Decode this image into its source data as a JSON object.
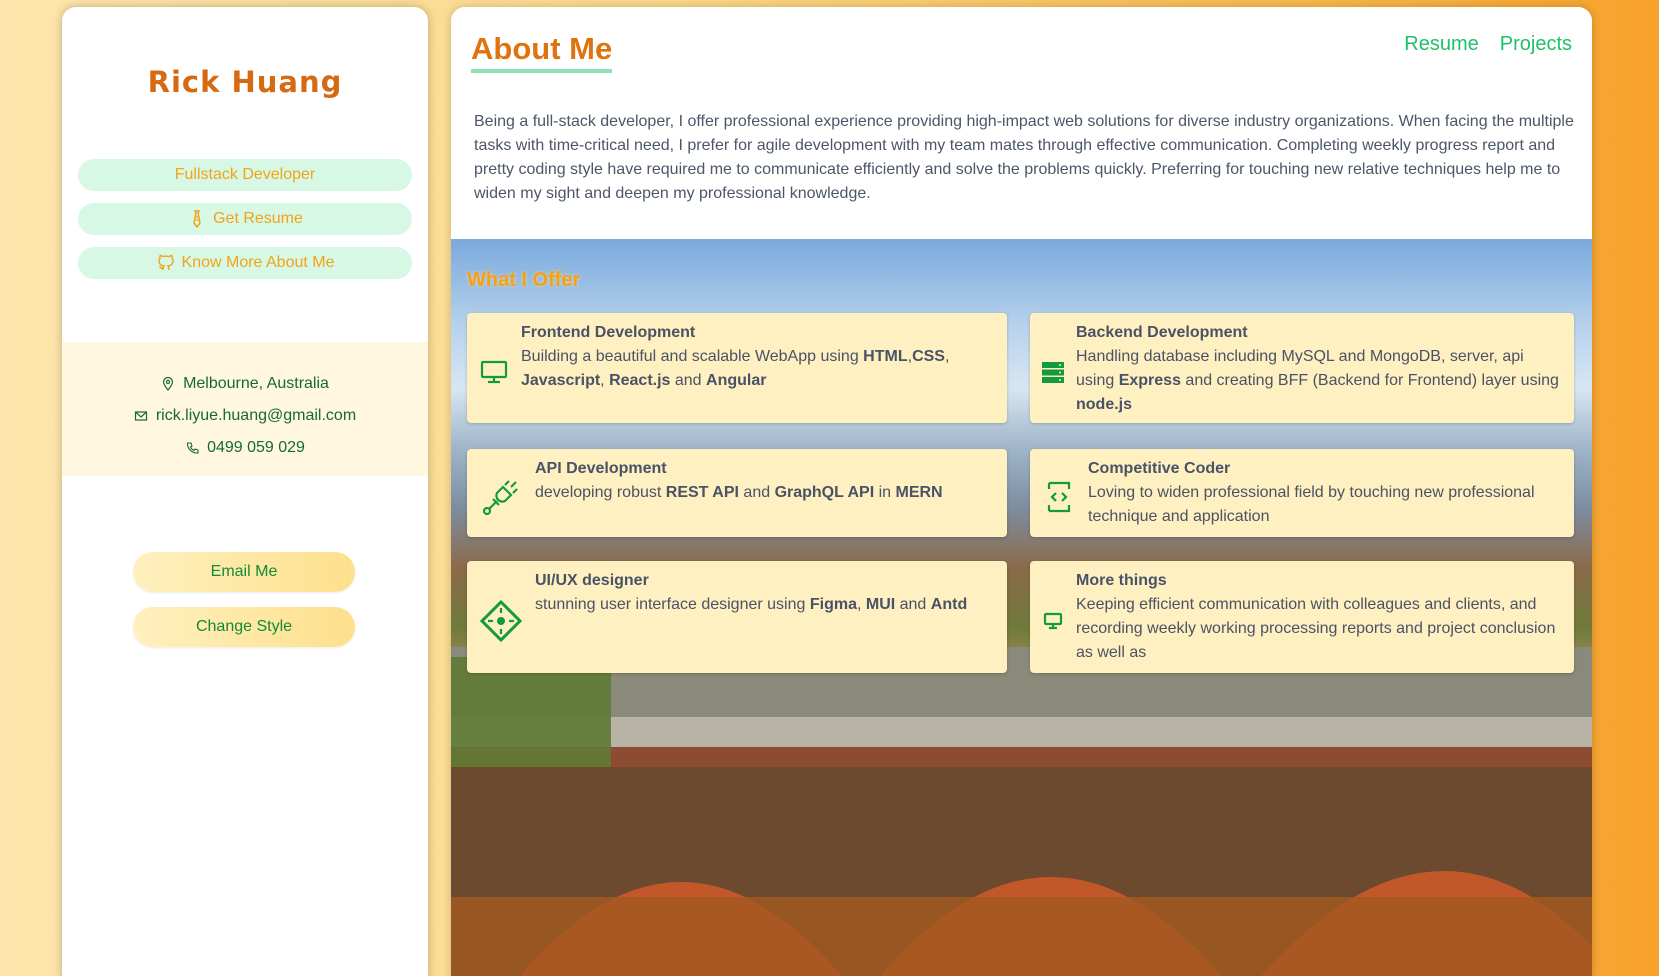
{
  "sidebar": {
    "name": "Rick Huang",
    "pills": [
      {
        "label": "Fullstack Developer",
        "icon": ""
      },
      {
        "label": "Get Resume",
        "icon": "tie-icon"
      },
      {
        "label": "Know More About Me",
        "icon": "github-icon"
      }
    ],
    "contact": {
      "location": "Melbourne, Australia",
      "email": "rick.liyue.huang@gmail.com",
      "phone": "0499 059 029"
    },
    "buttons": {
      "email": "Email Me",
      "style": "Change Style"
    }
  },
  "main": {
    "title": "About Me",
    "nav": [
      "Resume",
      "Projects"
    ],
    "about": "Being a full-stack developer, I offer professional experience providing high-impact web solutions for diverse industry organizations. When facing the multiple tasks with time-critical need, I prefer for agile development with my team mates through effective communication. Completing weekly progress report and pretty coding style have required me to communicate efficiently and solve the problems quickly. Preferring for touching new relative techniques help me to widen my sight and deepen my professional knowledge.",
    "offer_title": "What I Offer",
    "cards": [
      {
        "title": "Frontend Development",
        "icon": "monitor-icon",
        "parts": [
          "Building a beautiful and scalable WebApp using ",
          "HTML",
          ",",
          "CSS",
          ", ",
          "Javascript",
          ", ",
          "React.js",
          " and ",
          "Angular",
          ""
        ]
      },
      {
        "title": "Backend Development",
        "icon": "server-icon",
        "parts": [
          "Handling database including MySQL and MongoDB, server, api using ",
          "Express",
          " and creating BFF (Backend for Frontend) layer using ",
          "node.js",
          ""
        ]
      },
      {
        "title": "API Development",
        "icon": "api-plug-icon",
        "parts": [
          "developing robust ",
          "REST API",
          " and ",
          "GraphQL API",
          " in ",
          "MERN",
          ""
        ]
      },
      {
        "title": "Competitive Coder",
        "icon": "code-icon",
        "parts": [
          "Loving to widen professional field by touching new professional technique and application"
        ]
      },
      {
        "title": "UI/UX designer",
        "icon": "design-diamond-icon",
        "parts": [
          "stunning user interface designer using ",
          "Figma",
          ", ",
          "MUI",
          " and ",
          "Antd",
          ""
        ]
      },
      {
        "title": "More things",
        "icon": "monitor-small-icon",
        "parts": [
          "Keeping efficient communication with colleagues and clients, and recording weekly working processing reports and project conclusion as well as"
        ]
      }
    ]
  }
}
